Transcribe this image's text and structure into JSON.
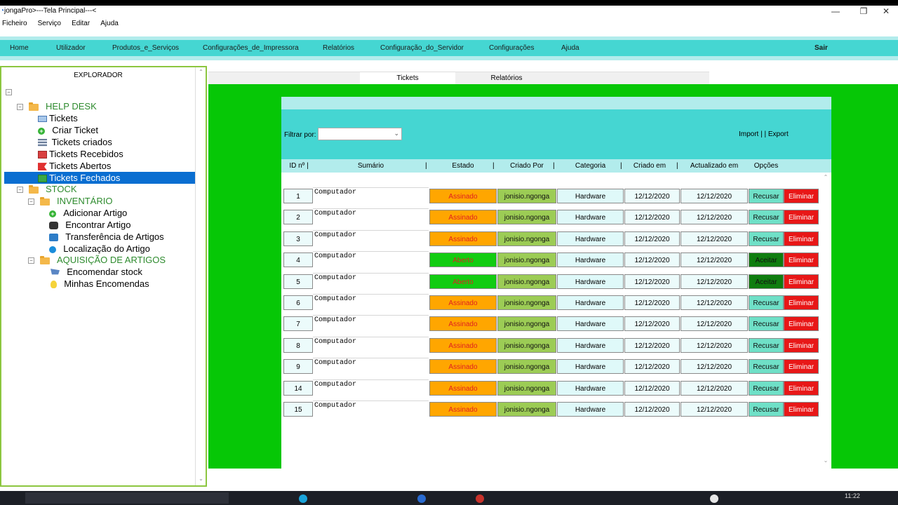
{
  "window": {
    "title": "jongaPro>---Tela Principal---<",
    "controls": [
      "—",
      "❐",
      "✕"
    ]
  },
  "menubar": [
    "Ficheiro",
    "Serviço",
    "Editar",
    "Ajuda"
  ],
  "navbar": [
    "Home",
    "Utilizador",
    "Produtos_e_Serviços",
    "Configurações_de_Impressora",
    "Relatórios",
    "Configuração_do_Servidor",
    "Configurações",
    "Ajuda"
  ],
  "navbar_exit": "Sair",
  "explorer": {
    "title": "EXPLORADOR",
    "collapse_glyph": "−",
    "helpdesk": "HELP DESK",
    "tickets": "Tickets",
    "criar_ticket": "Criar Ticket",
    "tickets_criados": "Tickets criados",
    "tickets_recebidos": "Tickets Recebidos",
    "tickets_abertos": "Tickets Abertos",
    "tickets_fechados": "Tickets Fechados",
    "stock": "STOCK",
    "inventario": "INVENTÁRIO",
    "adicionar_artigo": "Adicionar Artigo",
    "encontrar_artigo": "Encontrar Artigo",
    "transferencia": "Transferência de Artigos",
    "localizacao": "Localização do Artigo",
    "aquisicao": "AQUISIÇÃO DE ARTIGOS",
    "encomendar": "Encomendar stock",
    "minhas_encomendas": "Minhas Encomendas"
  },
  "tabs": {
    "tickets": "Tickets",
    "relatorios": "Relatórios"
  },
  "filter": {
    "label": "Filtrar por:",
    "import": "Import |",
    "export": "| Export"
  },
  "headers": {
    "id": "ID nº |",
    "sumario": "Sumário",
    "estado": "Estado",
    "criado_por": "Criado Por",
    "categoria": "Categoria",
    "criado_em": "Criado em",
    "actualizado_em": "Actualizado em",
    "opcoes": "Opções",
    "separator": "|"
  },
  "rows": [
    {
      "id": "1",
      "sumario": "Computador",
      "estado": "Assinado",
      "criado_por": "jonisio.ngonga",
      "categoria": "Hardware",
      "criado_em": "12/12/2020",
      "actualizado_em": "12/12/2020",
      "opcao": "Recusar",
      "eliminar": "Eliminar"
    },
    {
      "id": "2",
      "sumario": "Computador",
      "estado": "Assinado",
      "criado_por": "jonisio.ngonga",
      "categoria": "Hardware",
      "criado_em": "12/12/2020",
      "actualizado_em": "12/12/2020",
      "opcao": "Recusar",
      "eliminar": "Eliminar"
    },
    {
      "id": "3",
      "sumario": "Computador",
      "estado": "Assinado",
      "criado_por": "jonisio.ngonga",
      "categoria": "Hardware",
      "criado_em": "12/12/2020",
      "actualizado_em": "12/12/2020",
      "opcao": "Recusar",
      "eliminar": "Eliminar"
    },
    {
      "id": "4",
      "sumario": "Computador",
      "estado": "Aberto",
      "criado_por": "jonisio.ngonga",
      "categoria": "Hardware",
      "criado_em": "12/12/2020",
      "actualizado_em": "12/12/2020",
      "opcao": "Aceitar",
      "eliminar": "Eliminar"
    },
    {
      "id": "5",
      "sumario": "Computador",
      "estado": "Aberto",
      "criado_por": "jonisio.ngonga",
      "categoria": "Hardware",
      "criado_em": "12/12/2020",
      "actualizado_em": "12/12/2020",
      "opcao": "Aceitar",
      "eliminar": "Eliminar"
    },
    {
      "id": "6",
      "sumario": "Computador",
      "estado": "Assinado",
      "criado_por": "jonisio.ngonga",
      "categoria": "Hardware",
      "criado_em": "12/12/2020",
      "actualizado_em": "12/12/2020",
      "opcao": "Recusar",
      "eliminar": "Eliminar"
    },
    {
      "id": "7",
      "sumario": "Computador",
      "estado": "Assinado",
      "criado_por": "jonisio.ngonga",
      "categoria": "Hardware",
      "criado_em": "12/12/2020",
      "actualizado_em": "12/12/2020",
      "opcao": "Recusar",
      "eliminar": "Eliminar"
    },
    {
      "id": "8",
      "sumario": "Computador",
      "estado": "Assinado",
      "criado_por": "jonisio.ngonga",
      "categoria": "Hardware",
      "criado_em": "12/12/2020",
      "actualizado_em": "12/12/2020",
      "opcao": "Recusar",
      "eliminar": "Eliminar"
    },
    {
      "id": "9",
      "sumario": "Computador",
      "estado": "Assinado",
      "criado_por": "jonisio.ngonga",
      "categoria": "Hardware",
      "criado_em": "12/12/2020",
      "actualizado_em": "12/12/2020",
      "opcao": "Recusar",
      "eliminar": "Eliminar"
    },
    {
      "id": "14",
      "sumario": "Computador",
      "estado": "Assinado",
      "criado_por": "jonisio.ngonga",
      "categoria": "Hardware",
      "criado_em": "12/12/2020",
      "actualizado_em": "12/12/2020",
      "opcao": "Recusar",
      "eliminar": "Eliminar"
    },
    {
      "id": "15",
      "sumario": "Computador",
      "estado": "Assinado",
      "criado_por": "jonisio.ngonga",
      "categoria": "Hardware",
      "criado_em": "12/12/2020",
      "actualizado_em": "12/12/2020",
      "opcao": "Recusar",
      "eliminar": "Eliminar"
    }
  ],
  "colors": {
    "nav": "#45d6d2",
    "strip": "#b2ecec",
    "green_bg": "#06c706",
    "assinado": "#ffa600",
    "aberto": "#12cc12",
    "criado_por": "#9ccc55",
    "recusar": "#6fe0c7",
    "aceitar": "#0f7d0f",
    "eliminar": "#e81717",
    "selected": "#0a6ed1"
  },
  "taskbar": {
    "clock": "11:22"
  }
}
